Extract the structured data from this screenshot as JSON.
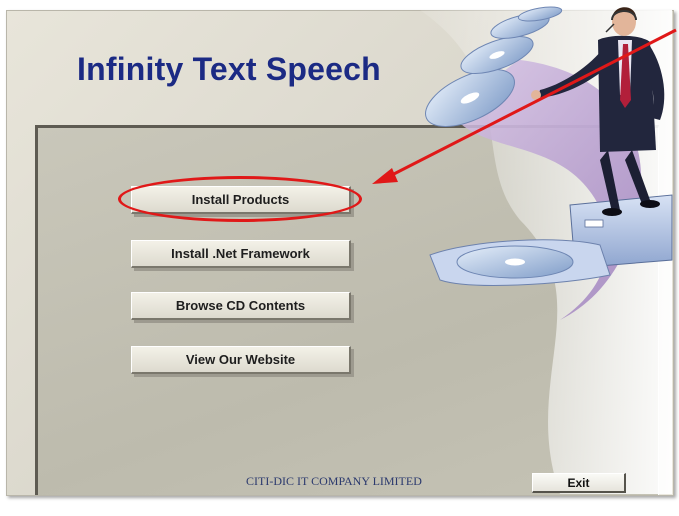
{
  "app": {
    "title": "Infinity Text Speech",
    "company": "CITI-DIC IT COMPANY LIMITED"
  },
  "menu": {
    "items": [
      {
        "label": "Install Products"
      },
      {
        "label": "Install .Net Framework"
      },
      {
        "label": "Browse CD Contents"
      },
      {
        "label": "View Our Website"
      }
    ],
    "highlighted_item": "Install Products"
  },
  "footer": {
    "exit_label": "Exit"
  },
  "annotation": {
    "highlight_color": "#e01818"
  },
  "illustration": {
    "subject": "businessman standing on CD-ROM drive with flying discs",
    "icons": [
      "businessman-illustration",
      "cd-disc-icon",
      "cd-drive-icon"
    ]
  }
}
